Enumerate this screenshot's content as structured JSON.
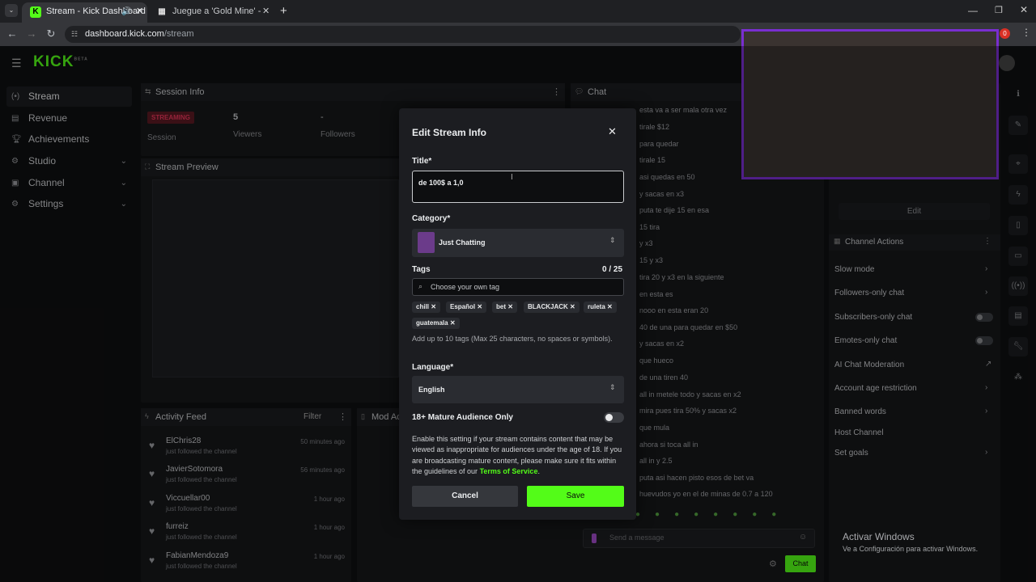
{
  "browser": {
    "tabs": [
      {
        "title": "Stream - Kick Dashboard",
        "favicon": "K"
      },
      {
        "title": "Juegue a 'Gold Mine' - Juegos d",
        "favicon": "▦"
      }
    ],
    "new_tab": "+",
    "url_host": "dashboard.kick.com",
    "url_path": "/stream",
    "notif_badge": "0"
  },
  "sidebar": {
    "logo": "KICK",
    "logo_sup": "BETA",
    "items": [
      {
        "label": "Stream"
      },
      {
        "label": "Revenue"
      },
      {
        "label": "Achievements"
      },
      {
        "label": "Studio"
      },
      {
        "label": "Channel"
      },
      {
        "label": "Settings"
      }
    ]
  },
  "session": {
    "title": "Session Info",
    "status": "STREAMING",
    "viewers_value": "5",
    "viewers_label": "Viewers",
    "followers_value": "-",
    "followers_label": "Followers",
    "session_label": "Session"
  },
  "preview": {
    "title": "Stream Preview"
  },
  "activity": {
    "title": "Activity Feed",
    "filter": "Filter",
    "items": [
      {
        "name": "ElChris28",
        "sub": "just followed the channel",
        "time": "50 minutes ago"
      },
      {
        "name": "JavierSotomora",
        "sub": "just followed the channel",
        "time": "56 minutes ago"
      },
      {
        "name": "Viccuellar00",
        "sub": "just followed the channel",
        "time": "1 hour ago"
      },
      {
        "name": "furreiz",
        "sub": "just followed the channel",
        "time": "1 hour ago"
      },
      {
        "name": "FabianMendoza9",
        "sub": "just followed the channel",
        "time": "1 hour ago"
      }
    ]
  },
  "mod": {
    "title": "Mod Ac"
  },
  "chat": {
    "title": "Chat",
    "lines": [
      "esta va a ser mala otra vez",
      "tirale $12",
      "para quedar",
      "tirale 15",
      "asi quedas en 50",
      "y sacas en x3",
      "puta te dije 15 en esa",
      "15 tira",
      "y x3",
      "15 y x3",
      "tira 20 y x3 en la siguiente",
      "en esta es",
      "nooo en esta eran 20",
      "40 de una para quedar en $50",
      "y sacas en x2",
      "que hueco",
      "de una tiren 40",
      "all in metele todo y sacas en x2",
      "mira pues tira 50% y sacas x2",
      "que mula",
      "ahora si toca all in",
      "all in y 2.5",
      "puta asi hacen pisto esos de bet va",
      "huevudos yo en el de minas de 0.7 a 120"
    ],
    "placeholder": "Send a message",
    "send": "Chat"
  },
  "channel_actions": {
    "edit": "Edit",
    "title": "Channel Actions",
    "items": [
      {
        "label": "Slow mode",
        "kind": "chevron"
      },
      {
        "label": "Followers-only chat",
        "kind": "chevron"
      },
      {
        "label": "Subscribers-only chat",
        "kind": "toggle"
      },
      {
        "label": "Emotes-only chat",
        "kind": "toggle"
      },
      {
        "label": "AI Chat Moderation",
        "kind": "link"
      },
      {
        "label": "Account age restriction",
        "kind": "chevron"
      },
      {
        "label": "Banned words",
        "kind": "chevron"
      },
      {
        "label": "Host Channel",
        "kind": "none"
      },
      {
        "label": "Set goals",
        "kind": "chevron"
      }
    ]
  },
  "modal": {
    "title": "Edit Stream Info",
    "title_label": "Title*",
    "title_value": "de 100$ a 1,0",
    "category_label": "Category*",
    "category_value": "Just Chatting",
    "tags_label": "Tags",
    "tags_count": "0 / 25",
    "tags_placeholder": "Choose your own tag",
    "tags": [
      "chill",
      "Español",
      "bet",
      "BLACKJACK",
      "ruleta",
      "guatemala"
    ],
    "tags_help": "Add up to 10 tags (Max 25 characters, no spaces or symbols).",
    "language_label": "Language*",
    "language_value": "English",
    "mature_label": "18+ Mature Audience Only",
    "mature_on": false,
    "mature_help": "Enable this setting if your stream contains content that may be viewed as inappropriate for audiences under the age of 18. If you are broadcasting mature content, please make sure it fits within the guidelines of our",
    "tos_link": "Terms of Service",
    "period": ".",
    "cancel": "Cancel",
    "save": "Save"
  },
  "windows_activation": {
    "title": "Activar Windows",
    "subtitle": "Ve a Configuración para activar Windows."
  },
  "colors": {
    "kick_green": "#53fc18",
    "streaming_red": "#e6365a"
  }
}
